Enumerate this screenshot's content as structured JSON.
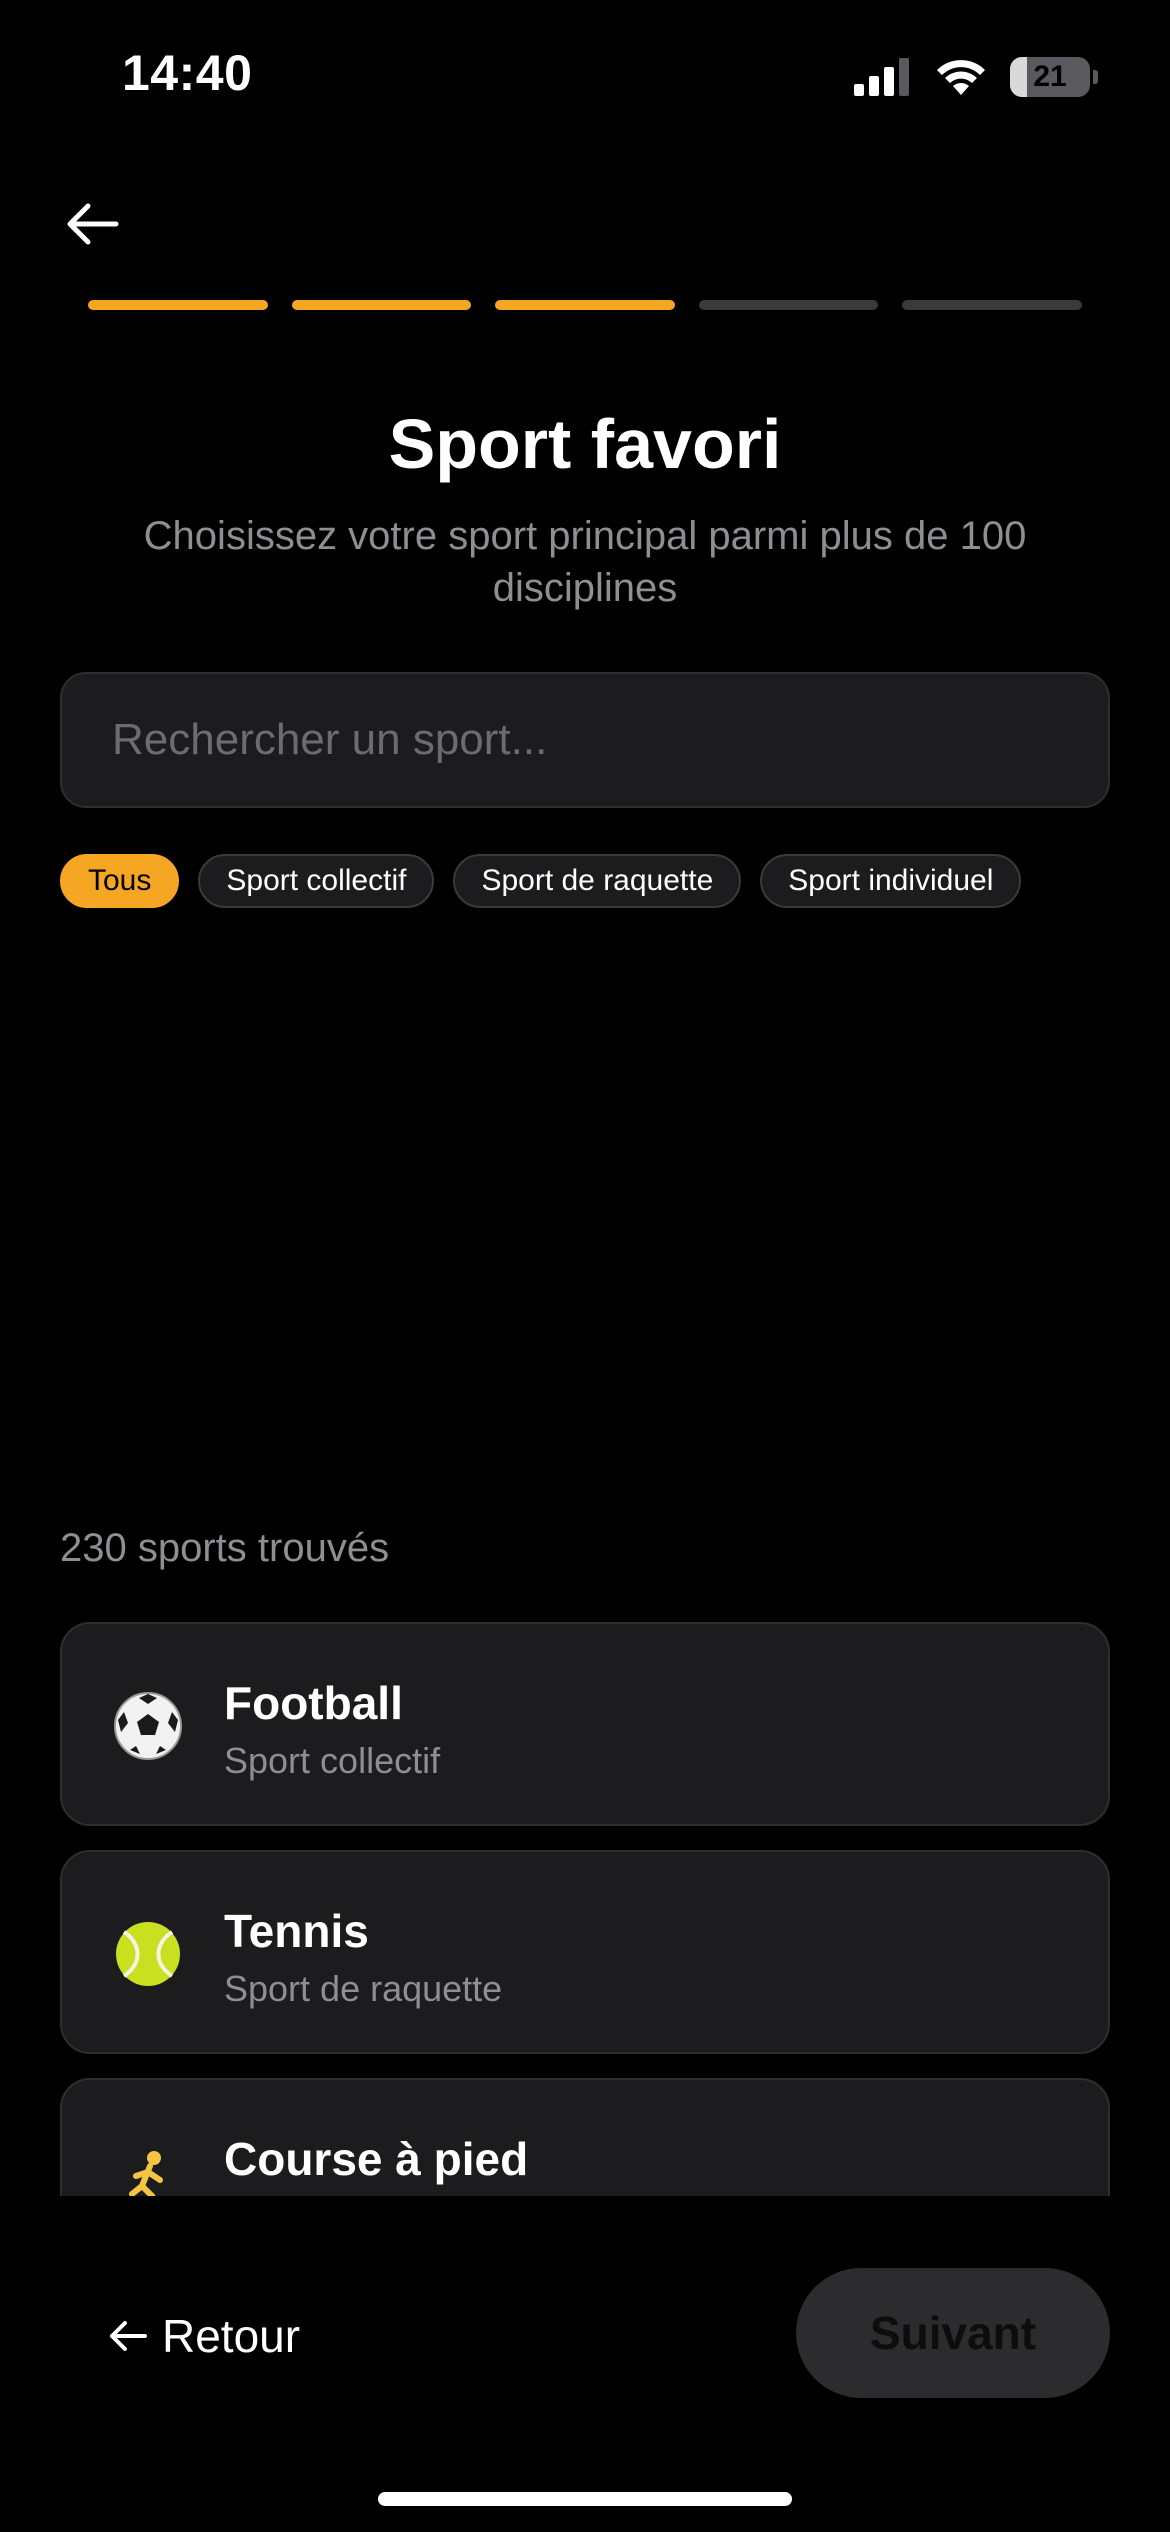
{
  "status_bar": {
    "time": "14:40",
    "battery": "21"
  },
  "progress": {
    "total_steps": 5,
    "completed_steps": 3,
    "accent_color": "#f5a623"
  },
  "header": {
    "title": "Sport favori",
    "subtitle": "Choisissez votre sport principal parmi plus de 100 disciplines"
  },
  "search": {
    "placeholder": "Rechercher un sport...",
    "value": ""
  },
  "filters": [
    {
      "label": "Tous",
      "selected": true
    },
    {
      "label": "Sport collectif",
      "selected": false
    },
    {
      "label": "Sport de raquette",
      "selected": false
    },
    {
      "label": "Sport individuel",
      "selected": false
    }
  ],
  "results": {
    "count_text": "230 sports trouvés",
    "items": [
      {
        "name": "Football",
        "category": "Sport collectif",
        "icon": "soccer-ball-icon"
      },
      {
        "name": "Tennis",
        "category": "Sport de raquette",
        "icon": "tennis-ball-icon"
      },
      {
        "name": "Course à pied",
        "category": "",
        "icon": "runner-icon"
      }
    ]
  },
  "footer": {
    "back_label": "Retour",
    "next_label": "Suivant"
  }
}
